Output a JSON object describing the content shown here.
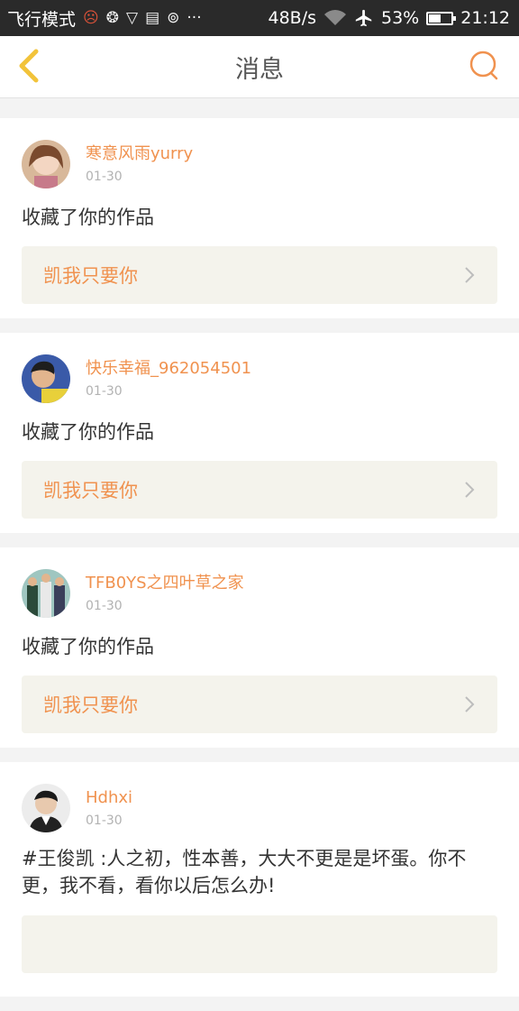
{
  "status_bar": {
    "mode": "飞行模式",
    "speed": "48B/s",
    "battery": "53%",
    "battery_level": 0.53,
    "time": "21:12",
    "icons": [
      "emoji-icon",
      "sync-icon",
      "shield-icon",
      "storage-icon",
      "usb-icon",
      "more-icon",
      "wifi-icon",
      "airplane-icon",
      "battery-icon"
    ]
  },
  "header": {
    "title": "消息",
    "back_icon": "chevron-left-icon",
    "search_icon": "search-icon"
  },
  "colors": {
    "accent": "#f0924f",
    "back_chevron": "#f2c33a",
    "work_bg": "#f4f3ec"
  },
  "messages": [
    {
      "username": "寒意风雨yurry",
      "date": "01-30",
      "text": "收藏了你的作品",
      "work": "凯我只要你"
    },
    {
      "username": "快乐幸福_962054501",
      "date": "01-30",
      "text": "收藏了你的作品",
      "work": "凯我只要你"
    },
    {
      "username": "TFB0YS之四叶草之家",
      "date": "01-30",
      "text": "收藏了你的作品",
      "work": "凯我只要你"
    },
    {
      "username": "Hdhxi",
      "date": "01-30",
      "text": "#王俊凯 :人之初，性本善，大大不更是是坏蛋。你不更，我不看，看你以后怎么办!"
    }
  ]
}
